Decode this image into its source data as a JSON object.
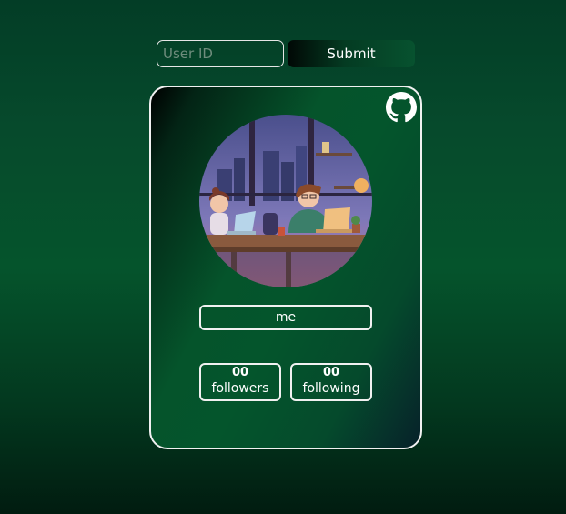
{
  "search": {
    "placeholder": "User ID",
    "value": "",
    "submit_label": "Submit"
  },
  "profile": {
    "name": "me",
    "followers": {
      "count": "00",
      "label": "followers"
    },
    "following": {
      "count": "00",
      "label": "following"
    }
  },
  "icons": {
    "corner": "github-icon",
    "avatar": "avatar-illustration"
  },
  "colors": {
    "card_border": "#f1f1f1",
    "background_green": "#05542c"
  }
}
